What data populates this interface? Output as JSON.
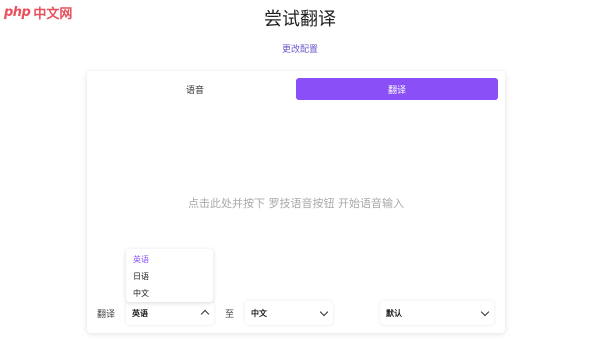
{
  "logo": {
    "php": "php",
    "site": "中文网"
  },
  "header": {
    "title": "尝试翻译",
    "config_link": "更改配置"
  },
  "tabs": [
    {
      "label": "语音",
      "active": false
    },
    {
      "label": "翻译",
      "active": true
    }
  ],
  "main": {
    "prompt": "点击此处并按下 罗技语音按钮 开始语音输入"
  },
  "controls": {
    "translate_label": "翻译",
    "to_label": "至",
    "source_language": "英语",
    "target_language": "中文",
    "mode": "默认"
  },
  "dropdown": {
    "options": [
      "英语",
      "日语",
      "中文"
    ],
    "selected": "英语"
  },
  "colors": {
    "accent": "#8a4ff7",
    "link": "#6a5acd",
    "logo": "#e8505b",
    "prompt": "#a9a9a9"
  }
}
